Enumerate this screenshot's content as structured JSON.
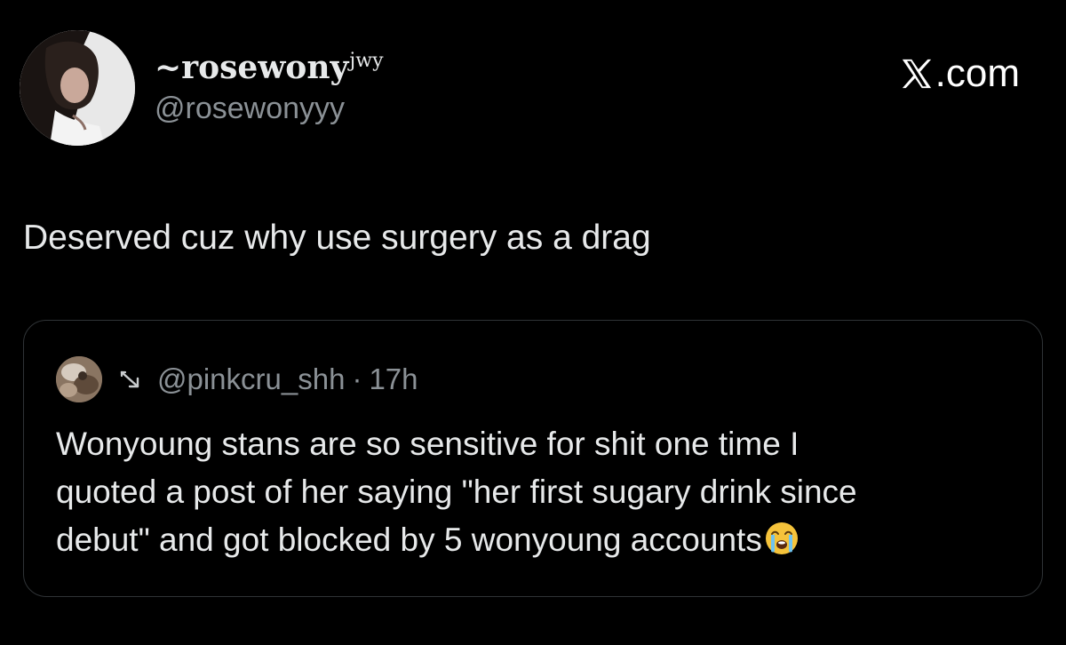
{
  "tweet": {
    "author": {
      "display_name": "~rosewony",
      "display_name_suffix": "jwy",
      "handle": "@rosewonyyy",
      "avatar_icon": "profile-photo-avatar"
    },
    "platform_label": ".com",
    "platform_icon": "x-logo-icon",
    "text": "Deserved cuz why use surgery as a drag"
  },
  "quoted_tweet": {
    "avatar_icon": "profile-photo-avatar",
    "indicator_icon": "arrow-icon",
    "handle": "@pinkcru_shh",
    "separator": "·",
    "time": "17h",
    "lines": [
      "Wonyoung stans are so sensitive for shit one time I",
      "quoted a post of her saying \"her first sugary drink since",
      "debut\" and got blocked by 5 wonyoung accounts"
    ],
    "emoji_icon": "loudly-crying-face-emoji"
  },
  "colors": {
    "background": "#000000",
    "primary_text": "#e7e9ea",
    "secondary_text": "#8b9196",
    "card_border": "#2f3336"
  }
}
